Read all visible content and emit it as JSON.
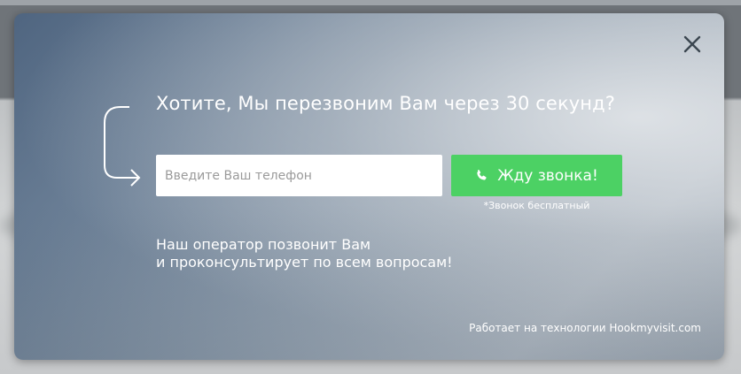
{
  "modal": {
    "close_icon": "close-icon",
    "arrow_icon": "curved-arrow-icon",
    "title": "Хотите, Мы перезвоним Вам через 30 секунд?",
    "phone_input": {
      "placeholder": "Введите Ваш телефон",
      "value": ""
    },
    "call_button": {
      "label": "Жду звонка!",
      "icon": "phone-icon"
    },
    "free_note": "*Звонок бесплатный",
    "description": {
      "line1": "Наш оператор позвонит Вам",
      "line2": "и проконсультирует по всем вопросам!"
    },
    "powered_by": "Работает на технологии Hookmyvisit.com"
  },
  "colors": {
    "button_green": "#4cd164",
    "text": "#ffffff",
    "input_bg": "#ffffff"
  }
}
